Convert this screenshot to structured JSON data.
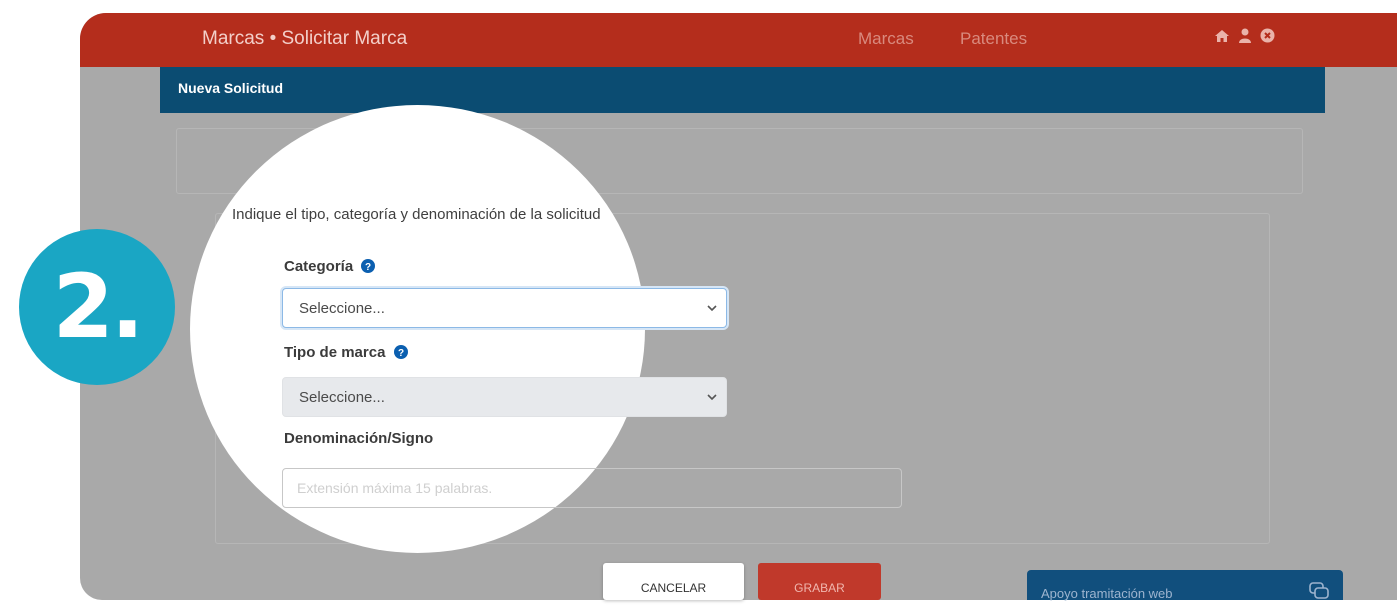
{
  "header": {
    "title": "Marcas • Solicitar Marca",
    "nav": {
      "marcas": "Marcas",
      "patentes": "Patentes"
    },
    "icons": [
      "home-icon",
      "user-icon",
      "close-circle-icon"
    ]
  },
  "subheader": {
    "title": "Nueva Solicitud"
  },
  "form": {
    "instruction": "Indique el tipo, categoría y denominación de la solicitud",
    "categoria": {
      "label": "Categoría",
      "value": "Seleccione..."
    },
    "tipo_marca": {
      "label": "Tipo de marca",
      "value": "Seleccione..."
    },
    "denominacion": {
      "label": "Denominación/Signo",
      "placeholder": "Extensión máxima 15 palabras."
    }
  },
  "buttons": {
    "cancel": "CANCELAR",
    "save": "GRABAR"
  },
  "support": {
    "label": "Apoyo tramitación web"
  },
  "step_badge": "2.",
  "colors": {
    "header_bg": "#b42d1c",
    "subheader_bg": "#0b4c72",
    "badge_bg": "#1aa6c4",
    "grabar_bg": "#c0392b",
    "help_icon": "#0b5fb0",
    "support_bg": "#114f7d"
  }
}
